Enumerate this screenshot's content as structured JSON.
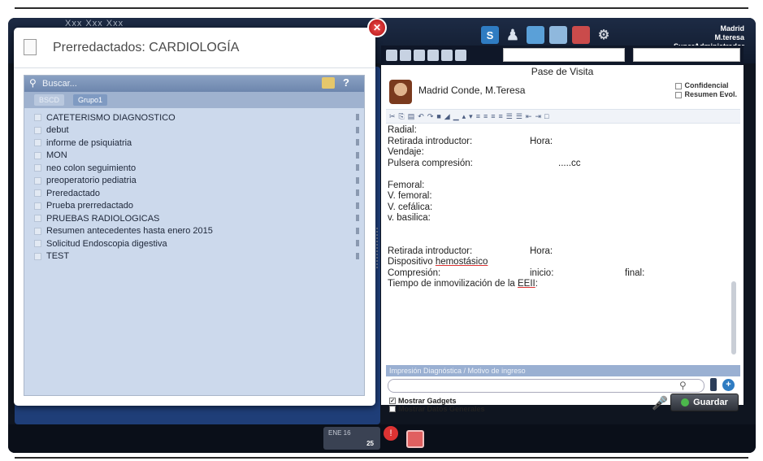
{
  "header": {
    "user_name": "Xxx Xxx Xxx",
    "location": "Madrid",
    "username": "M.teresa",
    "role": "SuperAdministrador"
  },
  "modal": {
    "title": "Prerredactados: CARDIOLOGÍA",
    "search_placeholder": "Buscar...",
    "filter_1": "BSCD",
    "filter_2": "Grupo1",
    "items": [
      "CATETERISMO DIAGNOSTICO",
      "debut",
      "informe de psiquiatria",
      "MON",
      "neo colon seguimiento",
      "preoperatorio pediatria",
      "Preredactado",
      "Prueba prerredactado",
      "PRUEBAS RADIOLOGICAS",
      "Resumen antecedentes  hasta enero 2015",
      "Solicitud Endoscopia digestiva",
      "TEST"
    ]
  },
  "visit": {
    "title": "Pase de Visita",
    "patient": "Madrid Conde, M.Teresa",
    "confidential": "Confidencial",
    "summary": "Resumen Evol."
  },
  "editor": {
    "radial": "Radial:",
    "retirada": "Retirada introductor:",
    "hora": "Hora:",
    "vendaje": "Vendaje:",
    "pulsera": "Pulsera compresión:",
    "cc": ".....cc",
    "femoral": "Femoral:",
    "v_femoral": "V. femoral:",
    "v_cefalica": "V. cefálica:",
    "v_basilica": "v. basilica:",
    "retirada2": "Retirada introductor:",
    "hora2": "Hora:",
    "dispositivo": "Dispositivo ",
    "hemostasico": "hemostásico",
    "compresion": "Compresión:",
    "inicio": "inicio:",
    "final": "final:",
    "tiempo": "Tiempo de inmovilización de la ",
    "eeii": "EEII"
  },
  "diagnosis": {
    "header": "Impresión Diagnóstica / Motivo de ingreso"
  },
  "footer": {
    "gadgets": "Mostrar Gadgets",
    "datos": "Mostrar Datos Generales",
    "save": "Guardar"
  },
  "taskbar": {
    "month": "ENE 16",
    "day": "25"
  }
}
